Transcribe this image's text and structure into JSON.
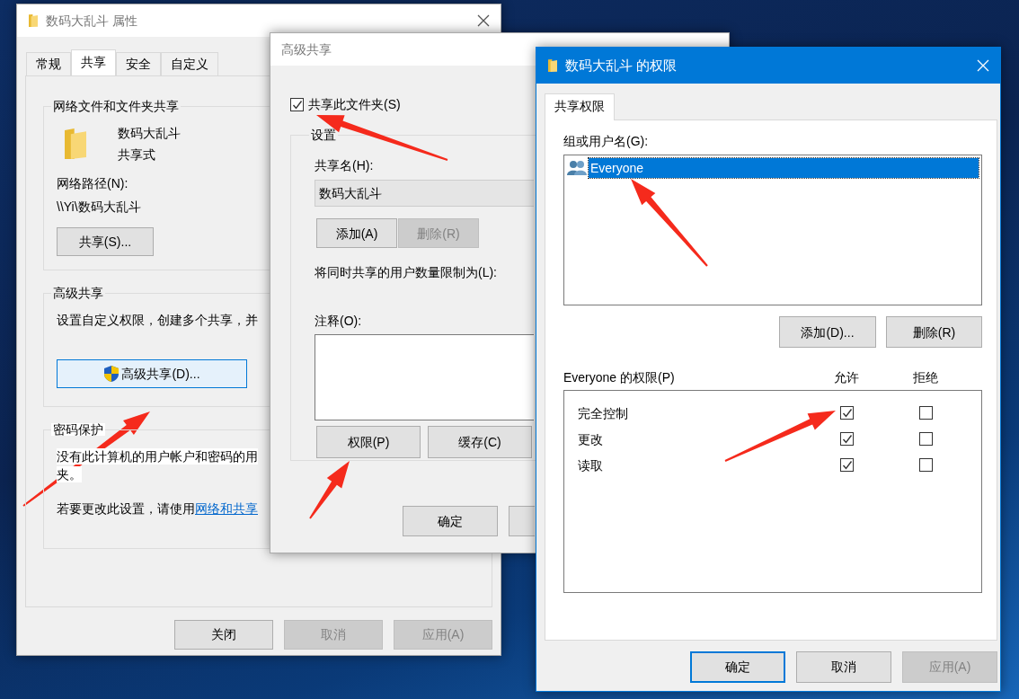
{
  "properties_window": {
    "title": "数码大乱斗 属性",
    "tabs": [
      {
        "label": "常规",
        "selected": false
      },
      {
        "label": "共享",
        "selected": true
      },
      {
        "label": "安全",
        "selected": false
      },
      {
        "label": "自定义",
        "selected": false
      }
    ],
    "network_sharing": {
      "heading": "网络文件和文件夹共享",
      "folder_name": "数码大乱斗",
      "folder_status": "共享式",
      "path_label": "网络路径(N):",
      "path": "\\\\Yi\\数码大乱斗",
      "share_button": "共享(S)..."
    },
    "advanced_sharing": {
      "heading": "高级共享",
      "description": "设置自定义权限，创建多个共享，并",
      "button": "高级共享(D)..."
    },
    "password_protection": {
      "heading": "密码保护",
      "description_lines": [
        "没有此计算机的用户帐户和密码的用",
        "夹。"
      ],
      "change_text": "若要更改此设置，请使用",
      "link": "网络和共享"
    },
    "buttons": [
      {
        "label": "关闭",
        "disabled": false
      },
      {
        "label": "取消",
        "disabled": true
      },
      {
        "label": "应用(A)",
        "disabled": true
      }
    ]
  },
  "advanced_sharing_window": {
    "title": "高级共享",
    "share_checkbox": {
      "label": "共享此文件夹(S)",
      "checked": true
    },
    "settings": {
      "heading": "设置",
      "share_name_label": "共享名(H):",
      "share_name": "数码大乱斗",
      "add_button": {
        "label": "添加(A)",
        "disabled": false
      },
      "remove_button": {
        "label": "删除(R)",
        "disabled": true
      },
      "limit_label": "将同时共享的用户数量限制为(L):",
      "comment_label": "注释(O):",
      "permissions_button": "权限(P)",
      "caching_button": "缓存(C)"
    },
    "buttons": [
      {
        "label": "确定"
      }
    ]
  },
  "permissions_window": {
    "title": "数码大乱斗 的权限",
    "tabs": [
      {
        "label": "共享权限",
        "selected": true
      }
    ],
    "group_label": "组或用户名(G):",
    "users": [
      {
        "name": "Everyone",
        "selected": true
      }
    ],
    "add_button": "添加(D)...",
    "remove_button": "删除(R)",
    "permissions_label": "Everyone 的权限(P)",
    "allow_label": "允许",
    "deny_label": "拒绝",
    "permissions": [
      {
        "name": "完全控制",
        "allow": true,
        "deny": false
      },
      {
        "name": "更改",
        "allow": true,
        "deny": false
      },
      {
        "name": "读取",
        "allow": true,
        "deny": false
      }
    ],
    "buttons": [
      {
        "label": "确定",
        "default": true,
        "disabled": false
      },
      {
        "label": "取消",
        "default": false,
        "disabled": false
      },
      {
        "label": "应用(A)",
        "default": false,
        "disabled": true
      }
    ]
  }
}
